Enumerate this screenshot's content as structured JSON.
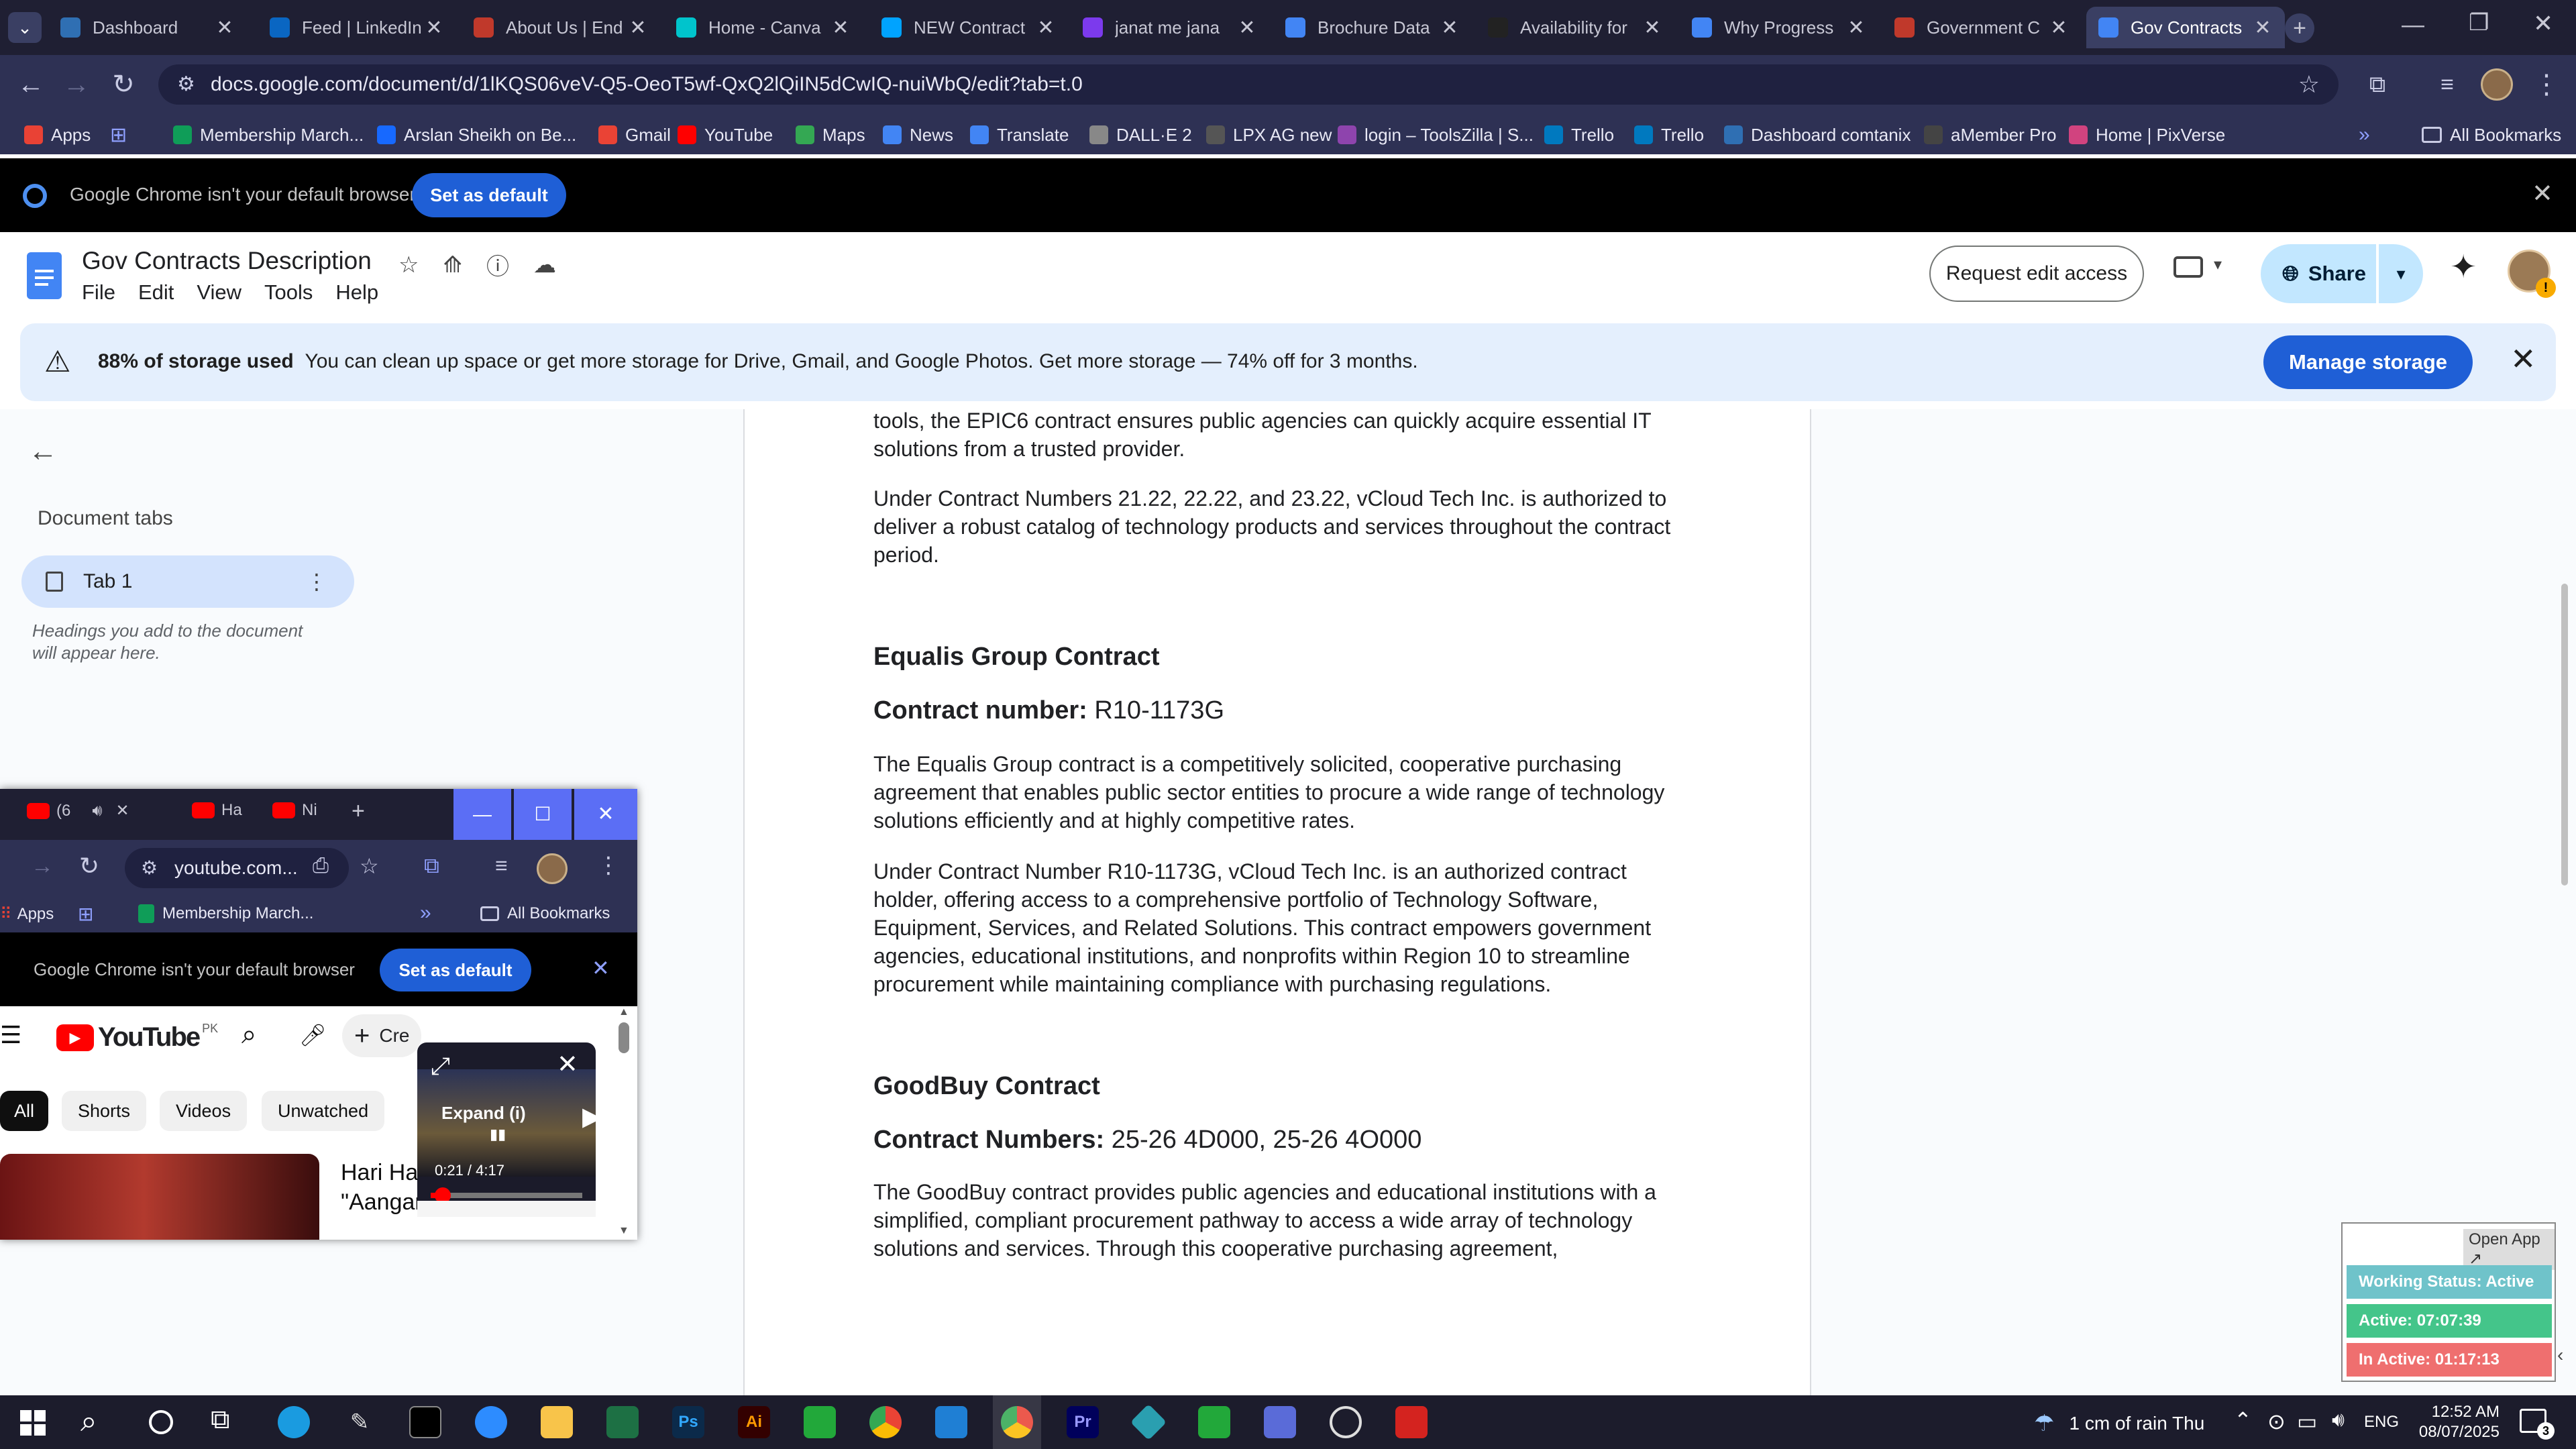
{
  "browser": {
    "tabs": [
      {
        "title": "Dashboard",
        "color": "#2f6fb3"
      },
      {
        "title": "Feed | LinkedIn",
        "color": "#0a66c2"
      },
      {
        "title": "About Us | End",
        "color": "#c0392b"
      },
      {
        "title": "Home - Canva",
        "color": "#00c4cc"
      },
      {
        "title": "NEW Contract",
        "color": "#00a3ff"
      },
      {
        "title": "janat me jana",
        "color": "#7c3aed"
      },
      {
        "title": "Brochure Data",
        "color": "#4285f4"
      },
      {
        "title": "Availability for",
        "color": "#222222"
      },
      {
        "title": "Why Progress",
        "color": "#4285f4"
      },
      {
        "title": "Government C",
        "color": "#c0392b"
      },
      {
        "title": "Gov Contracts",
        "color": "#4285f4"
      }
    ],
    "url": "docs.google.com/document/d/1lKQS06veV-Q5-OeoT5wf-QxQ2lQiIN5dCwIQ-nuiWbQ/edit?tab=t.0",
    "bookmarks": [
      {
        "label": "Apps",
        "color": "#e94235"
      },
      {
        "label": "Membership March...",
        "color": "#0f9d58"
      },
      {
        "label": "Arslan Sheikh on Be...",
        "color": "#1769ff"
      },
      {
        "label": "Gmail",
        "color": "#ea4335"
      },
      {
        "label": "YouTube",
        "color": "#ff0000"
      },
      {
        "label": "Maps",
        "color": "#34a853"
      },
      {
        "label": "News",
        "color": "#4285f4"
      },
      {
        "label": "Translate",
        "color": "#4285f4"
      },
      {
        "label": "DALL·E 2",
        "color": "#888888"
      },
      {
        "label": "LPX AG new",
        "color": "#555555"
      },
      {
        "label": "login – ToolsZilla | S...",
        "color": "#8e44ad"
      },
      {
        "label": "Trello",
        "color": "#0079bf"
      },
      {
        "label": "Trello",
        "color": "#0079bf"
      },
      {
        "label": "Dashboard comtanix",
        "color": "#2f6fb3"
      },
      {
        "label": "aMember Pro",
        "color": "#444444"
      },
      {
        "label": "Home | PixVerse",
        "color": "#d1437f"
      }
    ],
    "all_bookmarks": "All Bookmarks",
    "default_msg": "Google Chrome isn't your default browser",
    "set_default": "Set as default"
  },
  "docs": {
    "title": "Gov Contracts Description",
    "menu": [
      "File",
      "Edit",
      "View",
      "Tools",
      "Help"
    ],
    "request_edit": "Request edit access",
    "share": "Share",
    "storage": {
      "bold": "88% of storage used",
      "text": "You can clean up space or get more storage for Drive, Gmail, and Google Photos. Get more storage — 74% off for 3 months.",
      "button": "Manage storage"
    },
    "sidebar": {
      "heading": "Document tabs",
      "tab": "Tab 1",
      "hint": "Headings you add to the document will appear here."
    },
    "content": {
      "p0": "tools, the EPIC6 contract ensures public agencies can quickly acquire essential IT solutions from a trusted provider.",
      "p1": "Under Contract Numbers 21.22, 22.22, and 23.22, vCloud Tech Inc. is authorized to deliver a robust catalog of technology products and services throughout the contract period.",
      "h_equalis": "Equalis Group Contract",
      "equalis_num_label": "Contract number:",
      "equalis_num": "R10-1173G",
      "p2": "The Equalis Group contract is a competitively solicited, cooperative purchasing agreement that enables public sector entities to procure a wide range of technology solutions efficiently and at highly competitive rates.",
      "p3": "Under Contract Number R10-1173G, vCloud Tech Inc. is an authorized contract holder, offering access to a comprehensive portfolio of Technology Software, Equipment, Services, and Related Solutions. This contract empowers government agencies, educational institutions, and nonprofits within Region 10 to streamline procurement while maintaining compliance with purchasing regulations.",
      "h_goodbuy": "GoodBuy Contract",
      "goodbuy_num_label": "Contract Numbers:",
      "goodbuy_num": "25-26 4D000, 25-26 4O000",
      "p4": "The GoodBuy contract provides public agencies and educational institutions with a simplified, compliant procurement pathway to access a wide array of technology solutions and services. Through this cooperative purchasing agreement,"
    }
  },
  "youtube_window": {
    "tabs": [
      "(6",
      "Ha",
      "Ni"
    ],
    "url": "youtube.com...",
    "bm_apps": "Apps",
    "bm_membership": "Membership March...",
    "all_bookmarks": "All Bookmarks",
    "default_msg": "Google Chrome isn't your default browser",
    "set_default": "Set as default",
    "logo": "YouTube",
    "country": "PK",
    "create": "Cre",
    "chips": [
      "All",
      "Shorts",
      "Videos",
      "Unwatched"
    ],
    "video_title_1": "Hari Ha",
    "video_title_2": "\"Aangan\")",
    "mini_expand": "Expand (i)",
    "mini_time": "0:21 / 4:17",
    "mini_progress": 0.08
  },
  "tracker": {
    "open_app": "Open App ↗",
    "status": "Working Status: Active",
    "active": "Active: 07:07:39",
    "inactive": "In Active: 01:17:13",
    "colors": {
      "status": "#6fc3ca",
      "active": "#44c58a",
      "inactive": "#ef6f6f"
    }
  },
  "taskbar": {
    "weather": "1 cm of rain Thu",
    "lang": "ENG",
    "time": "12:52 AM",
    "date": "08/07/2025",
    "notif_count": "3"
  }
}
